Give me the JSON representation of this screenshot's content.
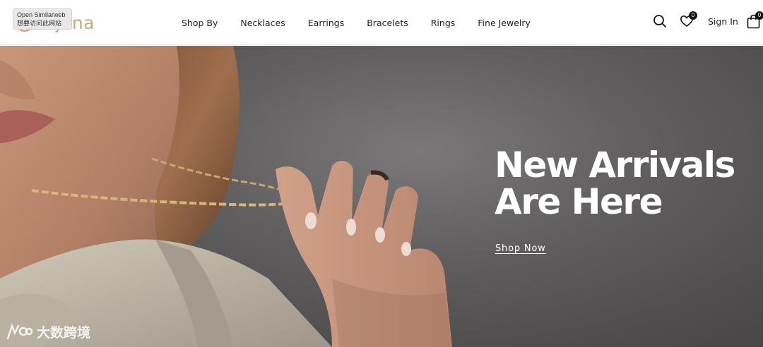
{
  "brand": {
    "name": "orjana",
    "accent": "#c9a77c"
  },
  "extension_tooltip": {
    "line1": "Open Similarweb",
    "line2": "想要访问此网站"
  },
  "nav": {
    "items": [
      "Shop By",
      "Necklaces",
      "Earrings",
      "Bracelets",
      "Rings",
      "Fine Jewelry"
    ]
  },
  "tools": {
    "search_icon": "search-icon",
    "wishlist_icon": "heart-icon",
    "wishlist_count": "0",
    "signin_label": "Sign In",
    "cart_icon": "shopping-bag-icon",
    "cart_count": "0"
  },
  "hero": {
    "title_line1": "New Arrivals",
    "title_line2": "Are Here",
    "cta_label": "Shop Now"
  },
  "watermark": {
    "text": "大数跨境"
  }
}
